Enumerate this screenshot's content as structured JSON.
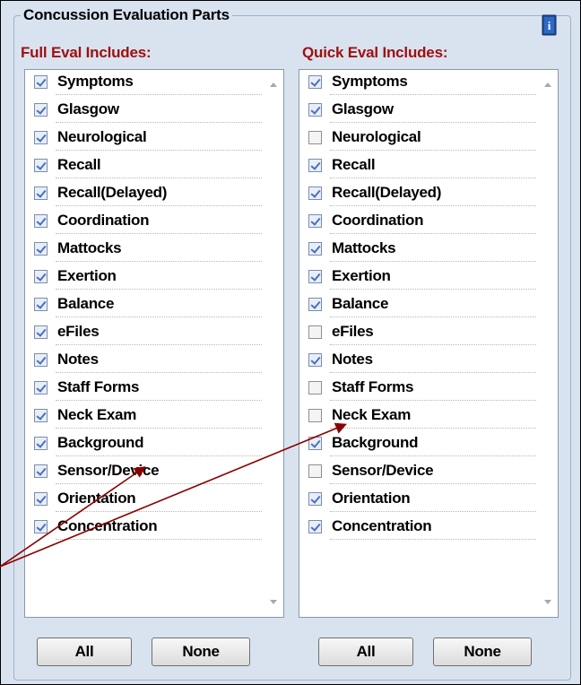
{
  "group_title": "Concussion Evaluation Parts",
  "icons": {
    "info": "info-book-icon"
  },
  "full_eval": {
    "header": "Full Eval Includes:",
    "items": [
      {
        "label": "Symptoms",
        "checked": true
      },
      {
        "label": "Glasgow",
        "checked": true
      },
      {
        "label": "Neurological",
        "checked": true
      },
      {
        "label": "Recall",
        "checked": true
      },
      {
        "label": "Recall(Delayed)",
        "checked": true
      },
      {
        "label": "Coordination",
        "checked": true
      },
      {
        "label": "Mattocks",
        "checked": true
      },
      {
        "label": "Exertion",
        "checked": true
      },
      {
        "label": "Balance",
        "checked": true
      },
      {
        "label": "eFiles",
        "checked": true
      },
      {
        "label": "Notes",
        "checked": true
      },
      {
        "label": "Staff Forms",
        "checked": true
      },
      {
        "label": "Neck Exam",
        "checked": true
      },
      {
        "label": "Background",
        "checked": true
      },
      {
        "label": "Sensor/Device",
        "checked": true
      },
      {
        "label": "Orientation",
        "checked": true
      },
      {
        "label": "Concentration",
        "checked": true
      }
    ],
    "all_label": "All",
    "none_label": "None"
  },
  "quick_eval": {
    "header": "Quick Eval Includes:",
    "items": [
      {
        "label": "Symptoms",
        "checked": true
      },
      {
        "label": "Glasgow",
        "checked": true
      },
      {
        "label": "Neurological",
        "checked": false
      },
      {
        "label": "Recall",
        "checked": true
      },
      {
        "label": "Recall(Delayed)",
        "checked": true
      },
      {
        "label": "Coordination",
        "checked": true
      },
      {
        "label": "Mattocks",
        "checked": true
      },
      {
        "label": "Exertion",
        "checked": true
      },
      {
        "label": "Balance",
        "checked": true
      },
      {
        "label": "eFiles",
        "checked": false
      },
      {
        "label": "Notes",
        "checked": true
      },
      {
        "label": "Staff Forms",
        "checked": false
      },
      {
        "label": "Neck Exam",
        "checked": false
      },
      {
        "label": "Background",
        "checked": true
      },
      {
        "label": "Sensor/Device",
        "checked": false
      },
      {
        "label": "Orientation",
        "checked": true
      },
      {
        "label": "Concentration",
        "checked": true
      }
    ],
    "all_label": "All",
    "none_label": "None"
  },
  "colors": {
    "header_text": "#a01010",
    "panel_bg": "#d9e3f0",
    "annotation_arrow": "#8b0000"
  }
}
